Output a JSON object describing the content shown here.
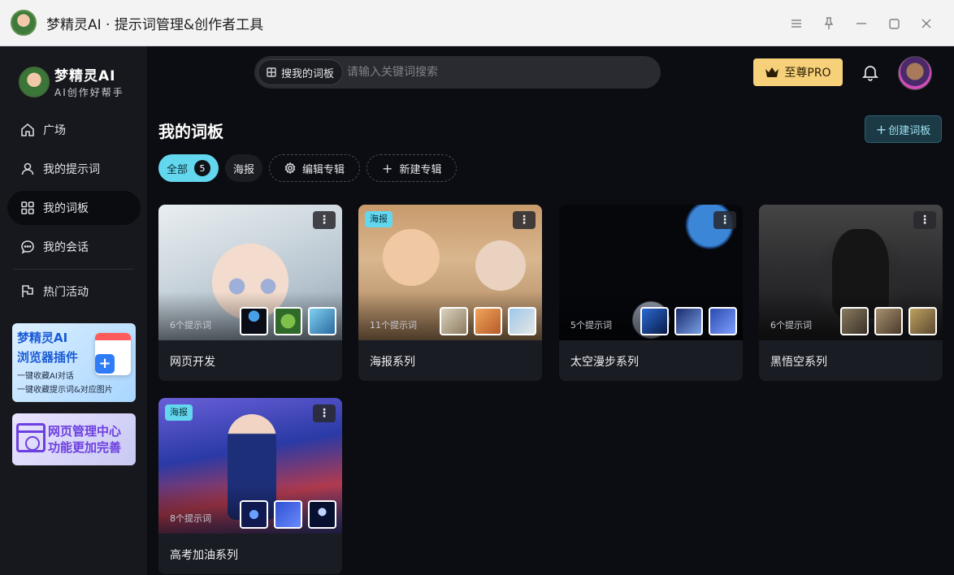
{
  "window": {
    "title": "梦精灵AI · 提示词管理&创作者工具"
  },
  "sidebar": {
    "brand_name": "梦精灵AI",
    "brand_sub": "AI创作好帮手",
    "items": [
      {
        "label": "广场",
        "icon": "home-icon"
      },
      {
        "label": "我的提示词",
        "icon": "user-icon"
      },
      {
        "label": "我的词板",
        "icon": "grid-icon",
        "active": true
      },
      {
        "label": "我的会话",
        "icon": "chat-icon"
      },
      {
        "label": "热门活动",
        "icon": "flag-icon"
      }
    ],
    "promo_plugin": {
      "title": "梦精灵AI",
      "title2": "浏览器插件",
      "line1": "一键收藏AI对话",
      "line2": "一键收藏提示词&对应图片"
    },
    "promo_web": {
      "line1": "网页管理中心",
      "line2": "功能更加完善"
    }
  },
  "topbar": {
    "search_scope": "搜我的词板",
    "search_placeholder": "请输入关键词搜索",
    "pro_label": "至尊PRO"
  },
  "page": {
    "title": "我的词板",
    "create_label": "创建词板"
  },
  "tabs": {
    "all_label": "全部",
    "all_count": "5",
    "poster_label": "海报",
    "edit_label": "编辑专辑",
    "new_label": "新建专辑"
  },
  "cards": [
    {
      "name": "网页开发",
      "count": "6个提示词",
      "tag": ""
    },
    {
      "name": "海报系列",
      "count": "11个提示词",
      "tag": "海报"
    },
    {
      "name": "太空漫步系列",
      "count": "5个提示词",
      "tag": ""
    },
    {
      "name": "黑悟空系列",
      "count": "6个提示词",
      "tag": ""
    },
    {
      "name": "高考加油系列",
      "count": "8个提示词",
      "tag": "海报"
    }
  ],
  "colors": {
    "accent": "#63d7ee",
    "pro_gold": "#f7d07a",
    "background": "#0c0d12"
  }
}
